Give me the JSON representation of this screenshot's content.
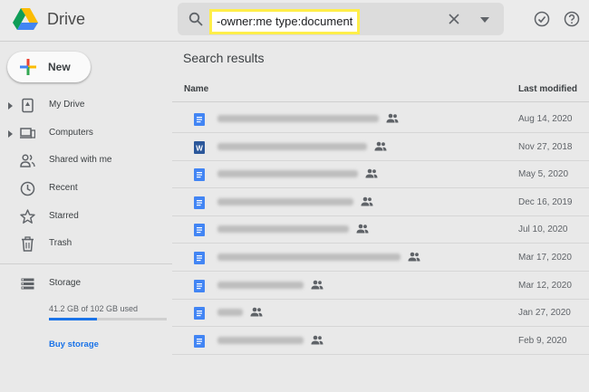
{
  "app": {
    "title": "Drive"
  },
  "search": {
    "query": "-owner:me type:document"
  },
  "sidebar": {
    "new_label": "New",
    "items": [
      {
        "label": "My Drive",
        "icon": "my-drive-icon",
        "expandable": true
      },
      {
        "label": "Computers",
        "icon": "computers-icon",
        "expandable": true
      },
      {
        "label": "Shared with me",
        "icon": "shared-with-me-icon",
        "expandable": false
      },
      {
        "label": "Recent",
        "icon": "clock-icon",
        "expandable": false
      },
      {
        "label": "Starred",
        "icon": "star-icon",
        "expandable": false
      },
      {
        "label": "Trash",
        "icon": "trash-icon",
        "expandable": false
      }
    ],
    "storage": {
      "label": "Storage",
      "usage_text": "41.2 GB of 102 GB used",
      "used_fraction": 0.404,
      "buy_label": "Buy storage"
    }
  },
  "main": {
    "title": "Search results",
    "columns": {
      "name": "Name",
      "modified": "Last modified"
    },
    "rows": [
      {
        "type": "gdoc",
        "shared": true,
        "modified": "Aug 14, 2020"
      },
      {
        "type": "word",
        "shared": true,
        "modified": "Nov 27, 2018"
      },
      {
        "type": "gdoc",
        "shared": true,
        "modified": "May 5, 2020"
      },
      {
        "type": "gdoc",
        "shared": true,
        "modified": "Dec 16, 2019"
      },
      {
        "type": "gdoc",
        "shared": true,
        "modified": "Jul 10, 2020"
      },
      {
        "type": "gdoc",
        "shared": true,
        "modified": "Mar 17, 2020"
      },
      {
        "type": "gdoc",
        "shared": true,
        "modified": "Mar 12, 2020"
      },
      {
        "type": "gdoc",
        "shared": true,
        "modified": "Jan 27, 2020"
      },
      {
        "type": "gdoc",
        "shared": true,
        "modified": "Feb 9, 2020"
      }
    ]
  },
  "colors": {
    "accent": "#1a73e8",
    "highlight": "#ffee4a",
    "doc_blue": "#4285f4",
    "word_blue": "#2b579a"
  }
}
